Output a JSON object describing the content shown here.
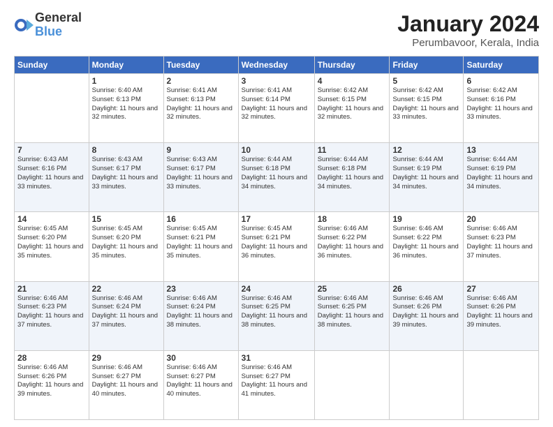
{
  "logo": {
    "general": "General",
    "blue": "Blue"
  },
  "title": "January 2024",
  "location": "Perumbavoor, Kerala, India",
  "headers": [
    "Sunday",
    "Monday",
    "Tuesday",
    "Wednesday",
    "Thursday",
    "Friday",
    "Saturday"
  ],
  "weeks": [
    [
      {
        "day": "",
        "sunrise": "",
        "sunset": "",
        "daylight": ""
      },
      {
        "day": "1",
        "sunrise": "Sunrise: 6:40 AM",
        "sunset": "Sunset: 6:13 PM",
        "daylight": "Daylight: 11 hours and 32 minutes."
      },
      {
        "day": "2",
        "sunrise": "Sunrise: 6:41 AM",
        "sunset": "Sunset: 6:13 PM",
        "daylight": "Daylight: 11 hours and 32 minutes."
      },
      {
        "day": "3",
        "sunrise": "Sunrise: 6:41 AM",
        "sunset": "Sunset: 6:14 PM",
        "daylight": "Daylight: 11 hours and 32 minutes."
      },
      {
        "day": "4",
        "sunrise": "Sunrise: 6:42 AM",
        "sunset": "Sunset: 6:15 PM",
        "daylight": "Daylight: 11 hours and 32 minutes."
      },
      {
        "day": "5",
        "sunrise": "Sunrise: 6:42 AM",
        "sunset": "Sunset: 6:15 PM",
        "daylight": "Daylight: 11 hours and 33 minutes."
      },
      {
        "day": "6",
        "sunrise": "Sunrise: 6:42 AM",
        "sunset": "Sunset: 6:16 PM",
        "daylight": "Daylight: 11 hours and 33 minutes."
      }
    ],
    [
      {
        "day": "7",
        "sunrise": "Sunrise: 6:43 AM",
        "sunset": "Sunset: 6:16 PM",
        "daylight": "Daylight: 11 hours and 33 minutes."
      },
      {
        "day": "8",
        "sunrise": "Sunrise: 6:43 AM",
        "sunset": "Sunset: 6:17 PM",
        "daylight": "Daylight: 11 hours and 33 minutes."
      },
      {
        "day": "9",
        "sunrise": "Sunrise: 6:43 AM",
        "sunset": "Sunset: 6:17 PM",
        "daylight": "Daylight: 11 hours and 33 minutes."
      },
      {
        "day": "10",
        "sunrise": "Sunrise: 6:44 AM",
        "sunset": "Sunset: 6:18 PM",
        "daylight": "Daylight: 11 hours and 34 minutes."
      },
      {
        "day": "11",
        "sunrise": "Sunrise: 6:44 AM",
        "sunset": "Sunset: 6:18 PM",
        "daylight": "Daylight: 11 hours and 34 minutes."
      },
      {
        "day": "12",
        "sunrise": "Sunrise: 6:44 AM",
        "sunset": "Sunset: 6:19 PM",
        "daylight": "Daylight: 11 hours and 34 minutes."
      },
      {
        "day": "13",
        "sunrise": "Sunrise: 6:44 AM",
        "sunset": "Sunset: 6:19 PM",
        "daylight": "Daylight: 11 hours and 34 minutes."
      }
    ],
    [
      {
        "day": "14",
        "sunrise": "Sunrise: 6:45 AM",
        "sunset": "Sunset: 6:20 PM",
        "daylight": "Daylight: 11 hours and 35 minutes."
      },
      {
        "day": "15",
        "sunrise": "Sunrise: 6:45 AM",
        "sunset": "Sunset: 6:20 PM",
        "daylight": "Daylight: 11 hours and 35 minutes."
      },
      {
        "day": "16",
        "sunrise": "Sunrise: 6:45 AM",
        "sunset": "Sunset: 6:21 PM",
        "daylight": "Daylight: 11 hours and 35 minutes."
      },
      {
        "day": "17",
        "sunrise": "Sunrise: 6:45 AM",
        "sunset": "Sunset: 6:21 PM",
        "daylight": "Daylight: 11 hours and 36 minutes."
      },
      {
        "day": "18",
        "sunrise": "Sunrise: 6:46 AM",
        "sunset": "Sunset: 6:22 PM",
        "daylight": "Daylight: 11 hours and 36 minutes."
      },
      {
        "day": "19",
        "sunrise": "Sunrise: 6:46 AM",
        "sunset": "Sunset: 6:22 PM",
        "daylight": "Daylight: 11 hours and 36 minutes."
      },
      {
        "day": "20",
        "sunrise": "Sunrise: 6:46 AM",
        "sunset": "Sunset: 6:23 PM",
        "daylight": "Daylight: 11 hours and 37 minutes."
      }
    ],
    [
      {
        "day": "21",
        "sunrise": "Sunrise: 6:46 AM",
        "sunset": "Sunset: 6:23 PM",
        "daylight": "Daylight: 11 hours and 37 minutes."
      },
      {
        "day": "22",
        "sunrise": "Sunrise: 6:46 AM",
        "sunset": "Sunset: 6:24 PM",
        "daylight": "Daylight: 11 hours and 37 minutes."
      },
      {
        "day": "23",
        "sunrise": "Sunrise: 6:46 AM",
        "sunset": "Sunset: 6:24 PM",
        "daylight": "Daylight: 11 hours and 38 minutes."
      },
      {
        "day": "24",
        "sunrise": "Sunrise: 6:46 AM",
        "sunset": "Sunset: 6:25 PM",
        "daylight": "Daylight: 11 hours and 38 minutes."
      },
      {
        "day": "25",
        "sunrise": "Sunrise: 6:46 AM",
        "sunset": "Sunset: 6:25 PM",
        "daylight": "Daylight: 11 hours and 38 minutes."
      },
      {
        "day": "26",
        "sunrise": "Sunrise: 6:46 AM",
        "sunset": "Sunset: 6:26 PM",
        "daylight": "Daylight: 11 hours and 39 minutes."
      },
      {
        "day": "27",
        "sunrise": "Sunrise: 6:46 AM",
        "sunset": "Sunset: 6:26 PM",
        "daylight": "Daylight: 11 hours and 39 minutes."
      }
    ],
    [
      {
        "day": "28",
        "sunrise": "Sunrise: 6:46 AM",
        "sunset": "Sunset: 6:26 PM",
        "daylight": "Daylight: 11 hours and 39 minutes."
      },
      {
        "day": "29",
        "sunrise": "Sunrise: 6:46 AM",
        "sunset": "Sunset: 6:27 PM",
        "daylight": "Daylight: 11 hours and 40 minutes."
      },
      {
        "day": "30",
        "sunrise": "Sunrise: 6:46 AM",
        "sunset": "Sunset: 6:27 PM",
        "daylight": "Daylight: 11 hours and 40 minutes."
      },
      {
        "day": "31",
        "sunrise": "Sunrise: 6:46 AM",
        "sunset": "Sunset: 6:27 PM",
        "daylight": "Daylight: 11 hours and 41 minutes."
      },
      {
        "day": "",
        "sunrise": "",
        "sunset": "",
        "daylight": ""
      },
      {
        "day": "",
        "sunrise": "",
        "sunset": "",
        "daylight": ""
      },
      {
        "day": "",
        "sunrise": "",
        "sunset": "",
        "daylight": ""
      }
    ]
  ]
}
